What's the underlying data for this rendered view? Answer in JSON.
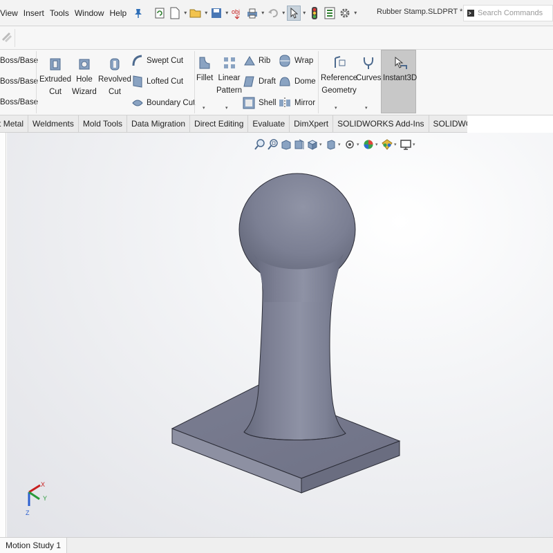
{
  "menu": {
    "items": [
      "View",
      "Insert",
      "Tools",
      "Window",
      "Help"
    ]
  },
  "document": {
    "title": "Rubber Stamp.SLDPRT *"
  },
  "search": {
    "placeholder": "Search Commands"
  },
  "ribbon": {
    "boss_top": "Boss/Base",
    "boss_mid": "Boss/Base",
    "boss_bot": "Boss/Base",
    "extruded_cut": [
      "Extruded",
      "Cut"
    ],
    "hole_wizard": [
      "Hole",
      "Wizard"
    ],
    "revolved_cut": [
      "Revolved",
      "Cut"
    ],
    "swept_cut": "Swept Cut",
    "lofted_cut": "Lofted Cut",
    "boundary_cut": "Boundary Cut",
    "fillet": "Fillet",
    "linear_pattern": [
      "Linear",
      "Pattern"
    ],
    "rib": "Rib",
    "draft": "Draft",
    "shell": "Shell",
    "wrap": "Wrap",
    "dome": "Dome",
    "mirror": "Mirror",
    "reference_geometry": [
      "Reference",
      "Geometry"
    ],
    "curves": "Curves",
    "instant3d": "Instant3D"
  },
  "tabs": [
    "Sheet Metal",
    "Weldments",
    "Mold Tools",
    "Data Migration",
    "Direct Editing",
    "Evaluate",
    "DimXpert",
    "SOLIDWORKS Add-Ins",
    "SOLIDWORKS MBD"
  ],
  "bottom": {
    "motion_study": "Motion Study 1"
  },
  "colors": {
    "model": "#7b7e8f",
    "accent": "#c31b1b",
    "ribbon_bg": "#f7f7f7"
  },
  "triad": {
    "x": "X",
    "y": "Y",
    "z": "Z"
  }
}
